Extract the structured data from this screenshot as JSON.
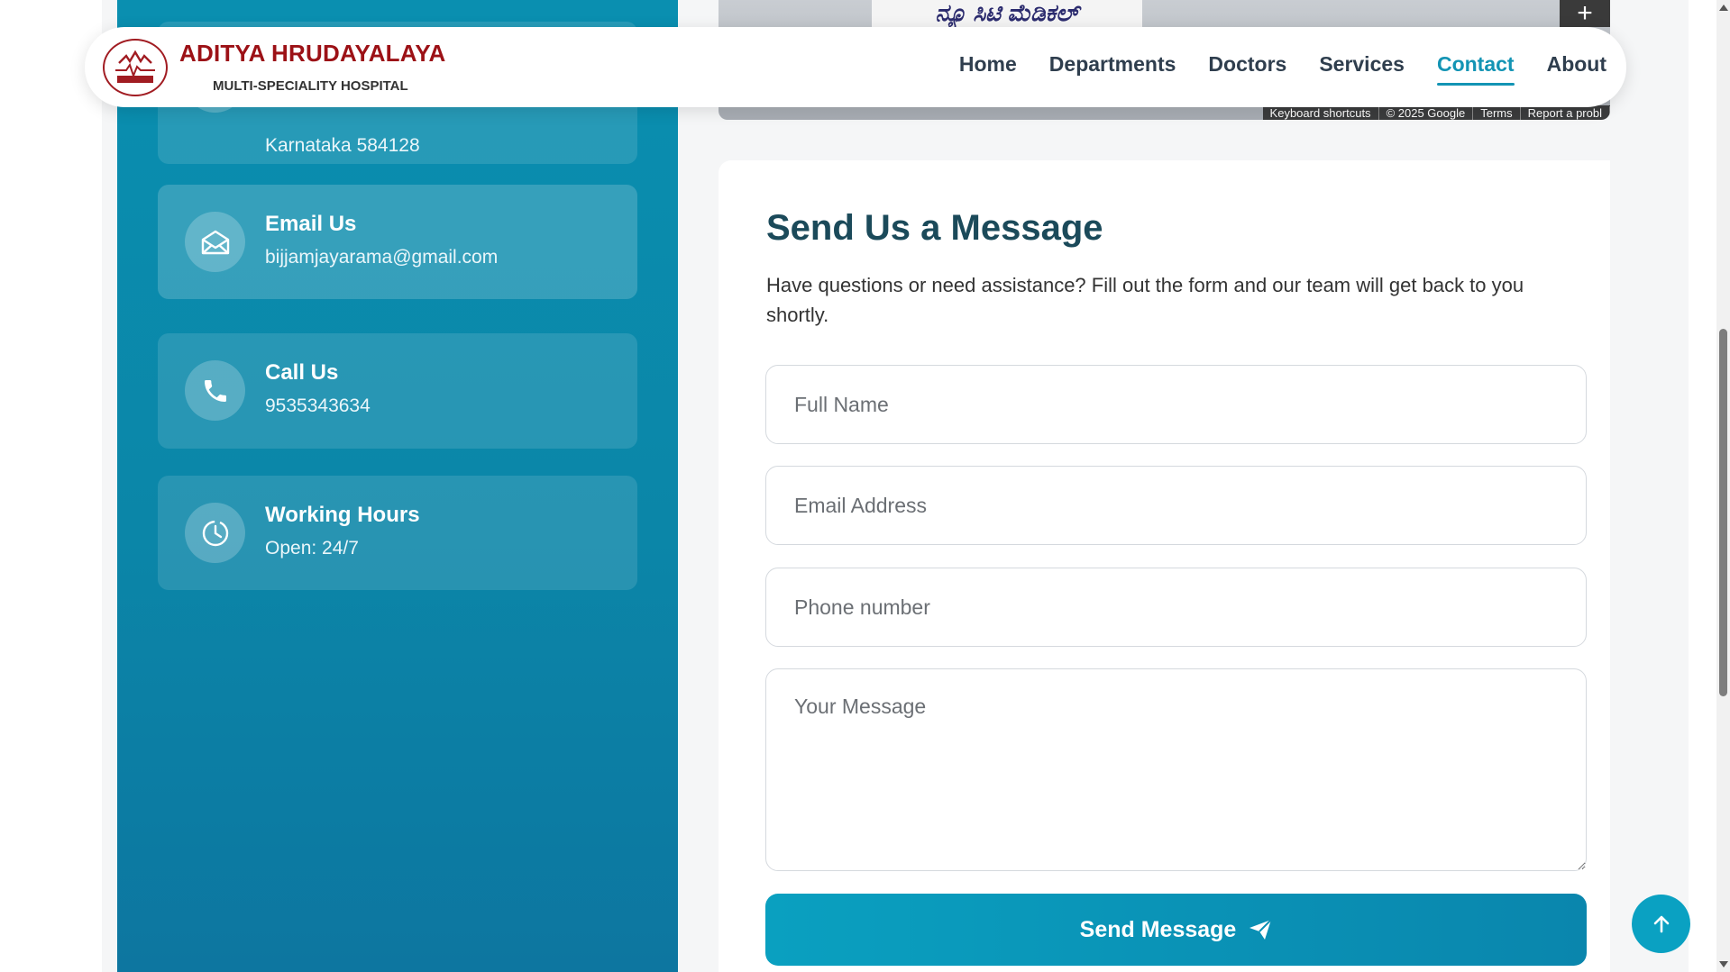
{
  "brand": {
    "name": "ADITYA HRUDAYALAYA",
    "subtitle": "MULTI-SPECIALITY HOSPITAL",
    "color": "#9c1116"
  },
  "nav": {
    "items": [
      {
        "label": "Home",
        "active": false
      },
      {
        "label": "Departments",
        "active": false
      },
      {
        "label": "Doctors",
        "active": false
      },
      {
        "label": "Services",
        "active": false
      },
      {
        "label": "Contact",
        "active": true
      },
      {
        "label": "About",
        "active": false
      }
    ],
    "accent": "#1394b4"
  },
  "contact": {
    "address": {
      "value": "Karnataka 584128",
      "icon": "location-icon"
    },
    "email": {
      "title": "Email Us",
      "value": "bijjamjayarama@gmail.com",
      "icon": "envelope-icon"
    },
    "phone": {
      "title": "Call Us",
      "value": "9535343634",
      "icon": "phone-icon"
    },
    "hours": {
      "title": "Working Hours",
      "value": "Open: 24/7",
      "icon": "clock-icon"
    }
  },
  "map": {
    "sign_text": "ನ್ಯೂ ಸಿಟಿ ಮೆಡಿಕಲ್",
    "zoom_in": "+",
    "attribution": [
      "Keyboard shortcuts",
      "© 2025 Google",
      "Terms",
      "Report a probl"
    ]
  },
  "form": {
    "title": "Send Us a Message",
    "description": "Have questions or need assistance? Fill out the form and our team will get back to you shortly.",
    "fields": {
      "name": {
        "placeholder": "Full Name",
        "value": ""
      },
      "email": {
        "placeholder": "Email Address",
        "value": ""
      },
      "phone": {
        "placeholder": "Phone number",
        "value": ""
      },
      "message": {
        "placeholder": "Your Message",
        "value": ""
      }
    },
    "submit_label": "Send Message"
  },
  "colors": {
    "panel": "#0a8fb0",
    "button": "#0a98ba",
    "title": "#1b4a5a"
  }
}
